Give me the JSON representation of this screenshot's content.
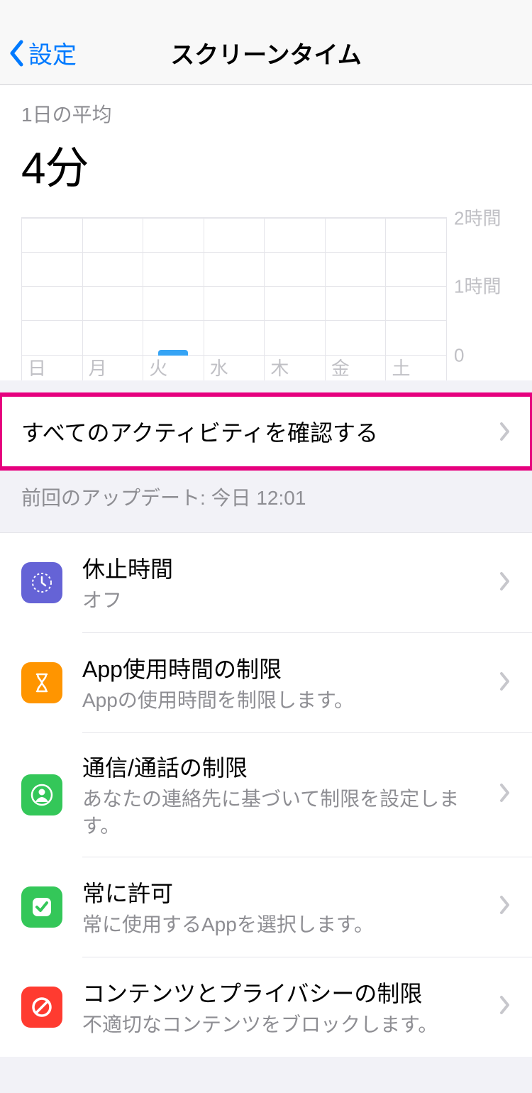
{
  "nav": {
    "back": "設定",
    "title": "スクリーンタイム"
  },
  "summary": {
    "avg_label": "1日の平均",
    "avg_value": "4分"
  },
  "chart_data": {
    "type": "bar",
    "categories": [
      "日",
      "月",
      "火",
      "水",
      "木",
      "金",
      "土"
    ],
    "values": [
      0,
      0,
      4,
      0,
      0,
      0,
      0
    ],
    "y_ticks": [
      "2時間",
      "1時間",
      "0"
    ],
    "ymax_minutes": 120,
    "title": "",
    "xlabel": "",
    "ylabel": "",
    "ylim": [
      0,
      120
    ]
  },
  "highlight": {
    "label": "すべてのアクティビティを確認する"
  },
  "update_note": "前回のアップデート: 今日 12:01",
  "menu": [
    {
      "title": "休止時間",
      "sub": "オフ",
      "icon": "downtime",
      "color": "#6563d6"
    },
    {
      "title": "App使用時間の制限",
      "sub": "Appの使用時間を制限します。",
      "icon": "hourglass",
      "color": "#ff9500"
    },
    {
      "title": "通信/通話の制限",
      "sub": "あなたの連絡先に基づいて制限を設定します。",
      "icon": "contact",
      "color": "#34c759"
    },
    {
      "title": "常に許可",
      "sub": "常に使用するAppを選択します。",
      "icon": "check",
      "color": "#34c759"
    },
    {
      "title": "コンテンツとプライバシーの制限",
      "sub": "不適切なコンテンツをブロックします。",
      "icon": "ban",
      "color": "#ff3b30"
    }
  ]
}
